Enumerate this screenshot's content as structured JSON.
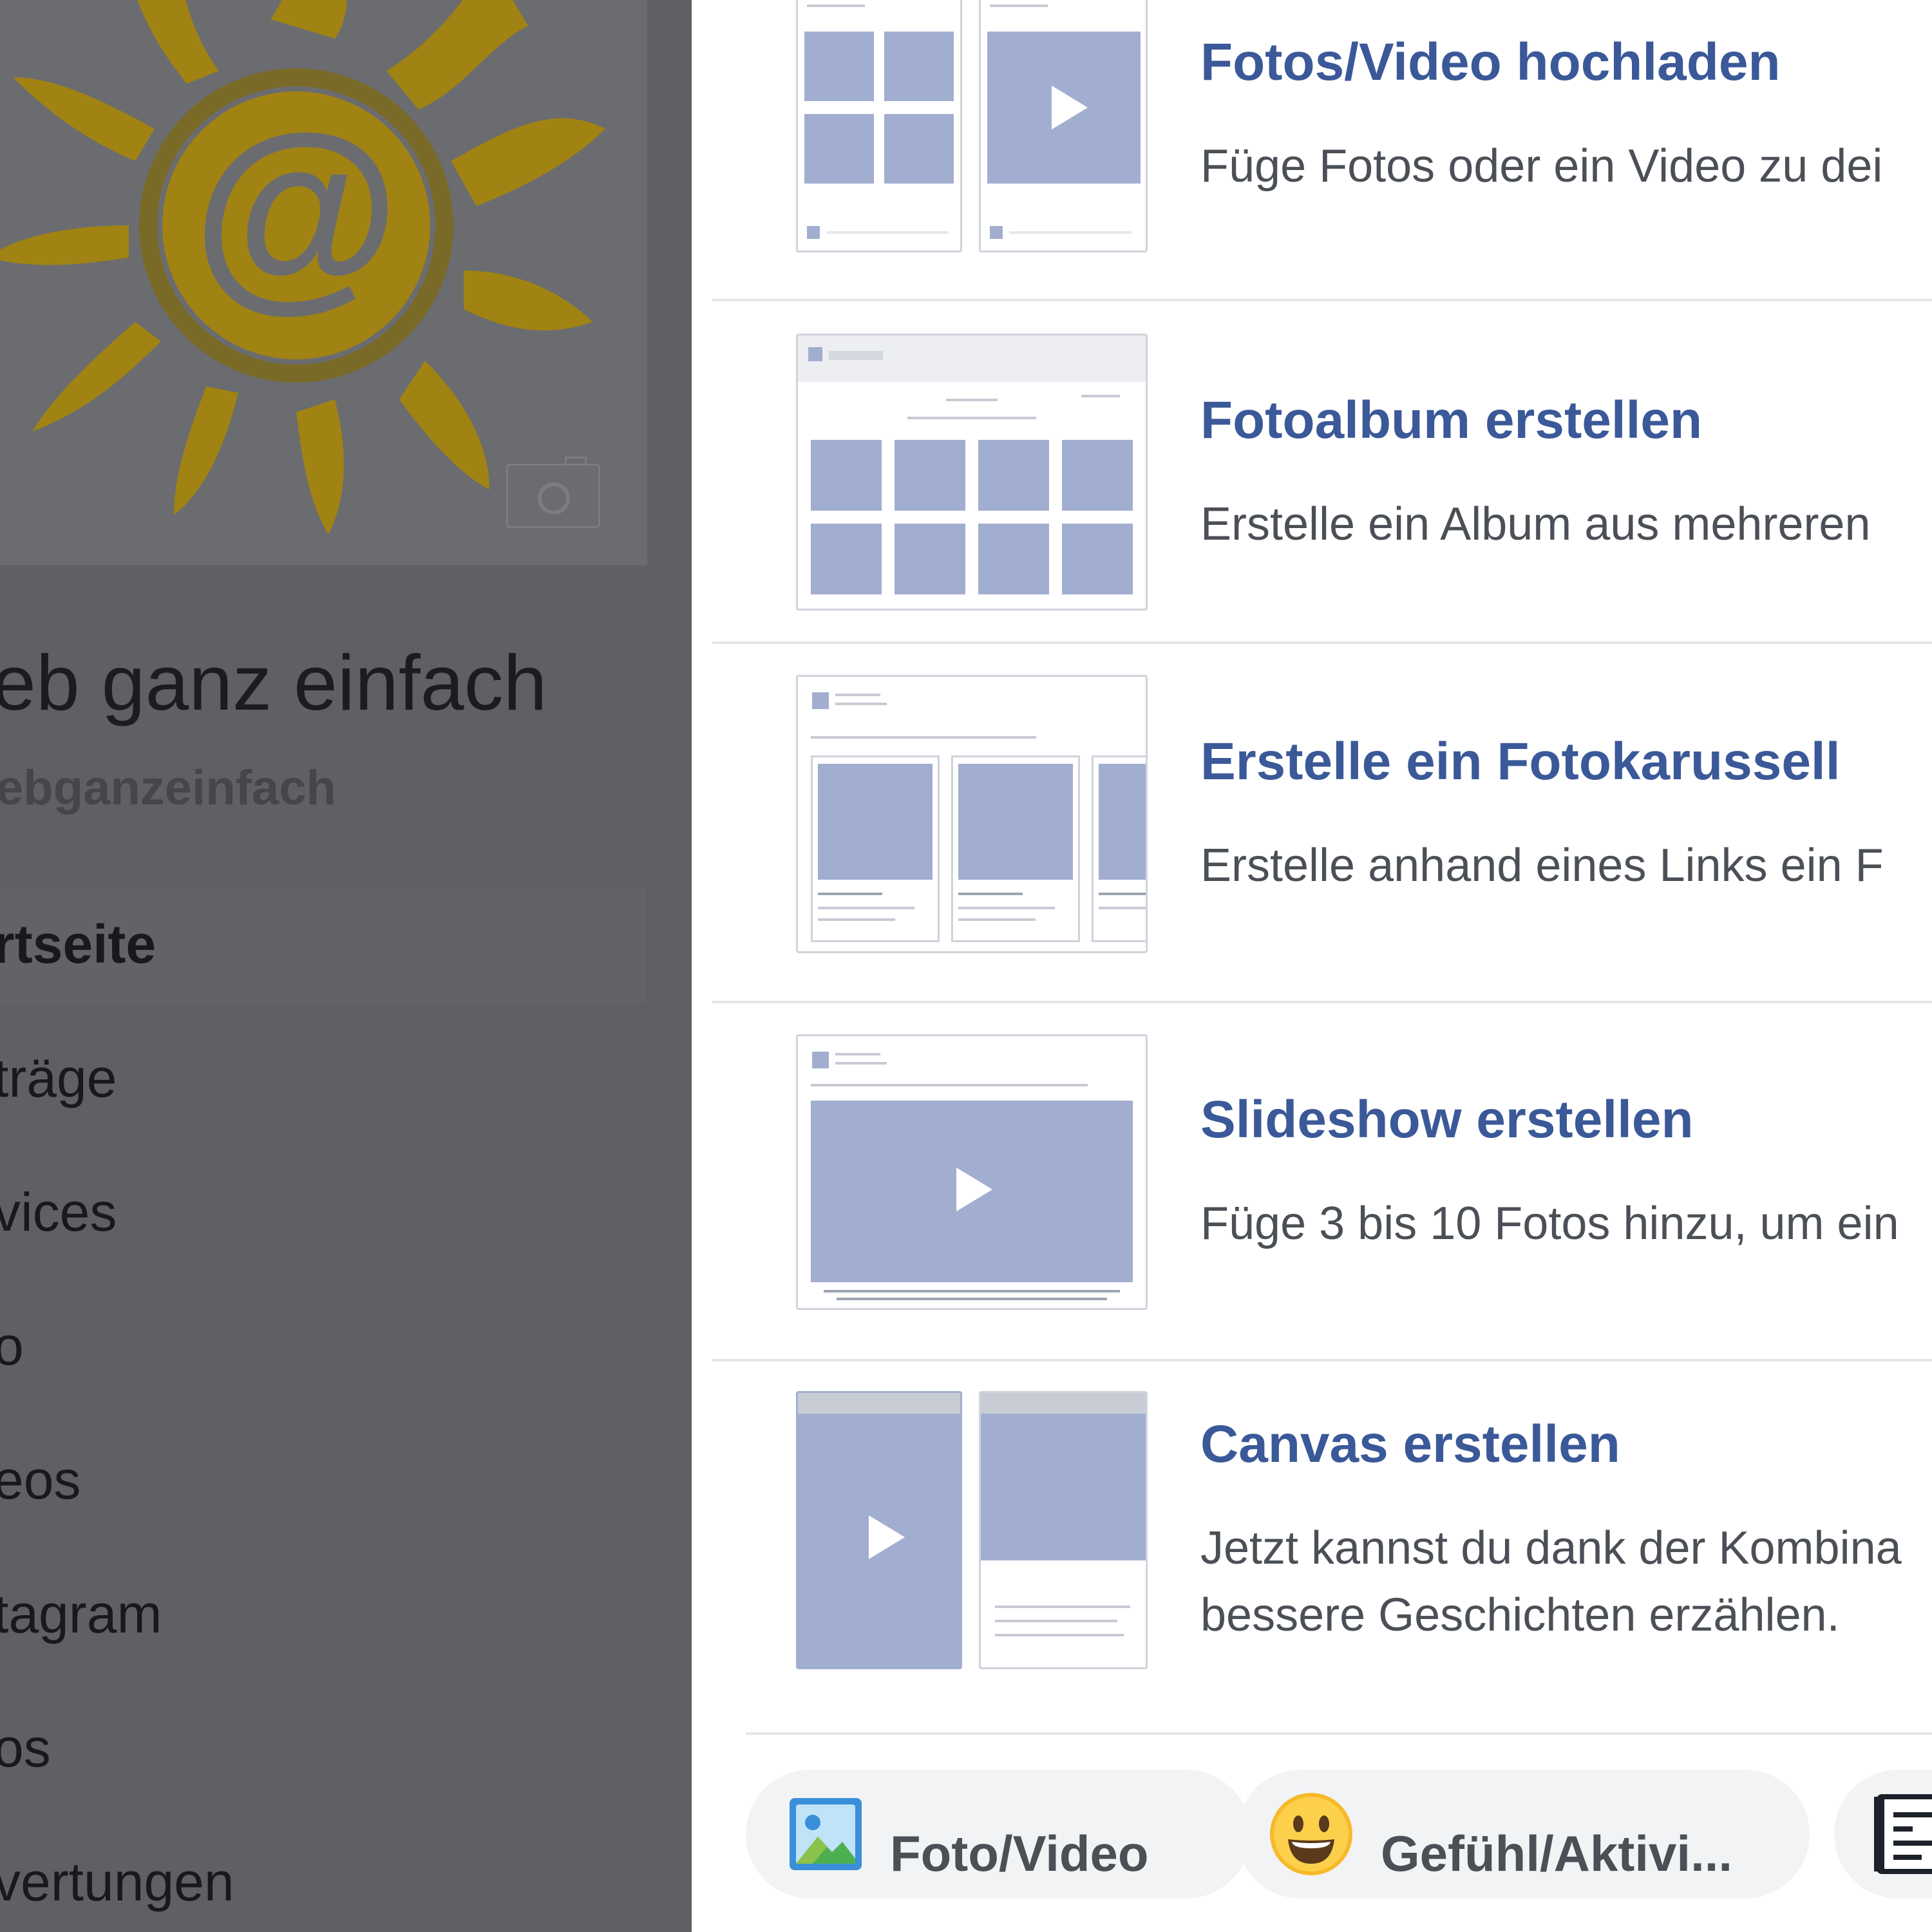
{
  "page": {
    "name": "eb ganz einfach",
    "handle": "ebganzeinfach"
  },
  "nav": [
    {
      "label": "rtseite",
      "active": true
    },
    {
      "label": "träge"
    },
    {
      "label": "vices"
    },
    {
      "label": "o"
    },
    {
      "label": "eos"
    },
    {
      "label": "tagram"
    },
    {
      "label": "os"
    },
    {
      "label": "vertungen"
    }
  ],
  "options": [
    {
      "title": "Fotos/Video hochladen",
      "desc": [
        "Füge Fotos oder ein Video zu dei"
      ]
    },
    {
      "title": "Fotoalbum erstellen",
      "desc": [
        "Erstelle ein Album aus mehreren"
      ]
    },
    {
      "title": "Erstelle ein Fotokarussell",
      "desc": [
        "Erstelle anhand eines Links ein F"
      ]
    },
    {
      "title": "Slideshow erstellen",
      "desc": [
        "Füge 3 bis 10 Fotos hinzu, um ein"
      ]
    },
    {
      "title": "Canvas erstellen",
      "desc": [
        "Jetzt kannst du dank der Kombina",
        "bessere Geschichten erzählen."
      ]
    }
  ],
  "composer": [
    {
      "label": "Foto/Video",
      "icon": "photo-icon"
    },
    {
      "label": "Gefühl/Aktivi...",
      "icon": "smiley-icon"
    },
    {
      "label": "",
      "icon": "list-icon"
    }
  ],
  "colors": {
    "accent": "#3b5998",
    "logo": "#a08312",
    "overlay": "#5f6063",
    "placeholder": "#a2aed0"
  }
}
